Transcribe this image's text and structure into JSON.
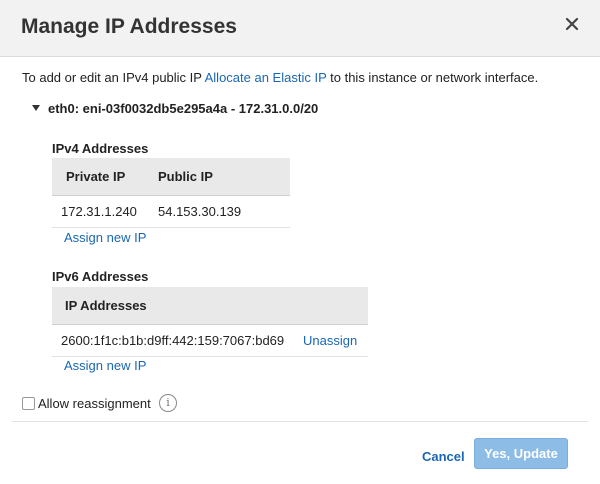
{
  "dialog": {
    "title": "Manage IP Addresses",
    "intro_prefix": "To add or edit an IPv4 public IP",
    "intro_link": "Allocate an Elastic IP",
    "intro_suffix": "to this instance or network interface.",
    "interface_label": "eth0: eni-03f0032db5e295a4a - 172.31.0.0/20"
  },
  "ipv4": {
    "title": "IPv4 Addresses",
    "columns": [
      "Private IP",
      "Public IP"
    ],
    "rows": [
      {
        "private_ip": "172.31.1.240",
        "public_ip": "54.153.30.139"
      }
    ],
    "assign_label": "Assign new IP"
  },
  "ipv6": {
    "title": "IPv6 Addresses",
    "columns": [
      "IP Addresses"
    ],
    "rows": [
      {
        "address": "2600:1f1c:b1b:d9ff:442:159:7067:bd69",
        "action": "Unassign"
      }
    ],
    "assign_label": "Assign new IP"
  },
  "footer": {
    "reassign_label": "Allow reassignment",
    "reassign_checked": false,
    "info_glyph": "i",
    "cancel_label": "Cancel",
    "confirm_label": "Yes, Update"
  },
  "colors": {
    "link": "#1a67b5",
    "primary_button": "#8dbde6",
    "header_bg": "#f2f2f2"
  },
  "icons": {
    "close": "close-icon",
    "expand": "caret-down-icon",
    "info": "info-icon"
  }
}
